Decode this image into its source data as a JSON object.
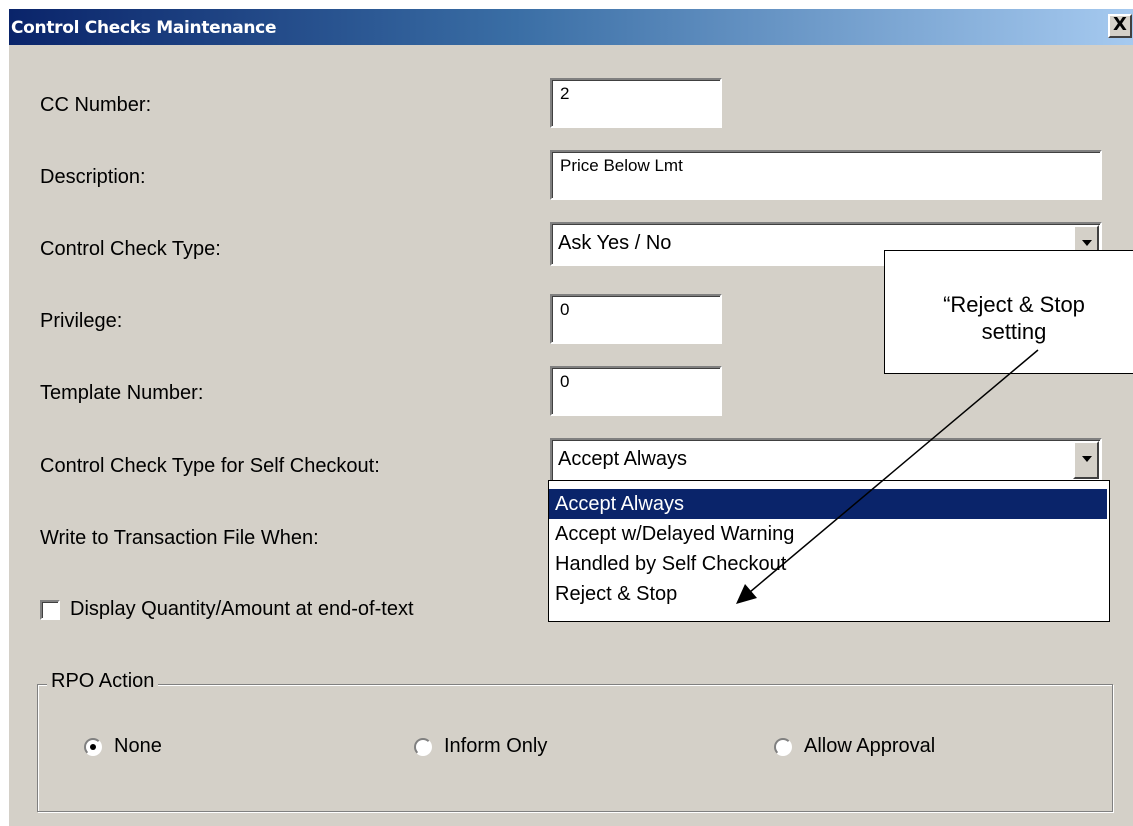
{
  "window": {
    "title": "Control Checks Maintenance",
    "close_label": "X"
  },
  "form": {
    "cc_number": {
      "label": "CC Number:",
      "value": "2"
    },
    "description": {
      "label": "Description:",
      "value": "Price Below Lmt"
    },
    "control_check_type": {
      "label": "Control Check Type:",
      "value": "Ask Yes / No"
    },
    "privilege": {
      "label": "Privilege:",
      "value": "0"
    },
    "template_number": {
      "label": "Template Number:",
      "value": "0"
    },
    "self_checkout_type": {
      "label": "Control Check Type for Self Checkout:",
      "value": "Accept Always",
      "options": [
        "Accept Always",
        "Accept w/Delayed Warning",
        "Handled by Self Checkout",
        "Reject & Stop"
      ],
      "highlighted": "Accept Always"
    },
    "write_to_transaction": {
      "label": "Write to Transaction File When:"
    },
    "display_quantity": {
      "label": "Display Quantity/Amount at end-of-text",
      "checked": false
    }
  },
  "rpo_action": {
    "legend": "RPO Action",
    "options": [
      "None",
      "Inform Only",
      "Allow Approval"
    ],
    "selected": "None"
  },
  "annotation": {
    "line1": "“Reject & Stop",
    "line2": "setting"
  }
}
